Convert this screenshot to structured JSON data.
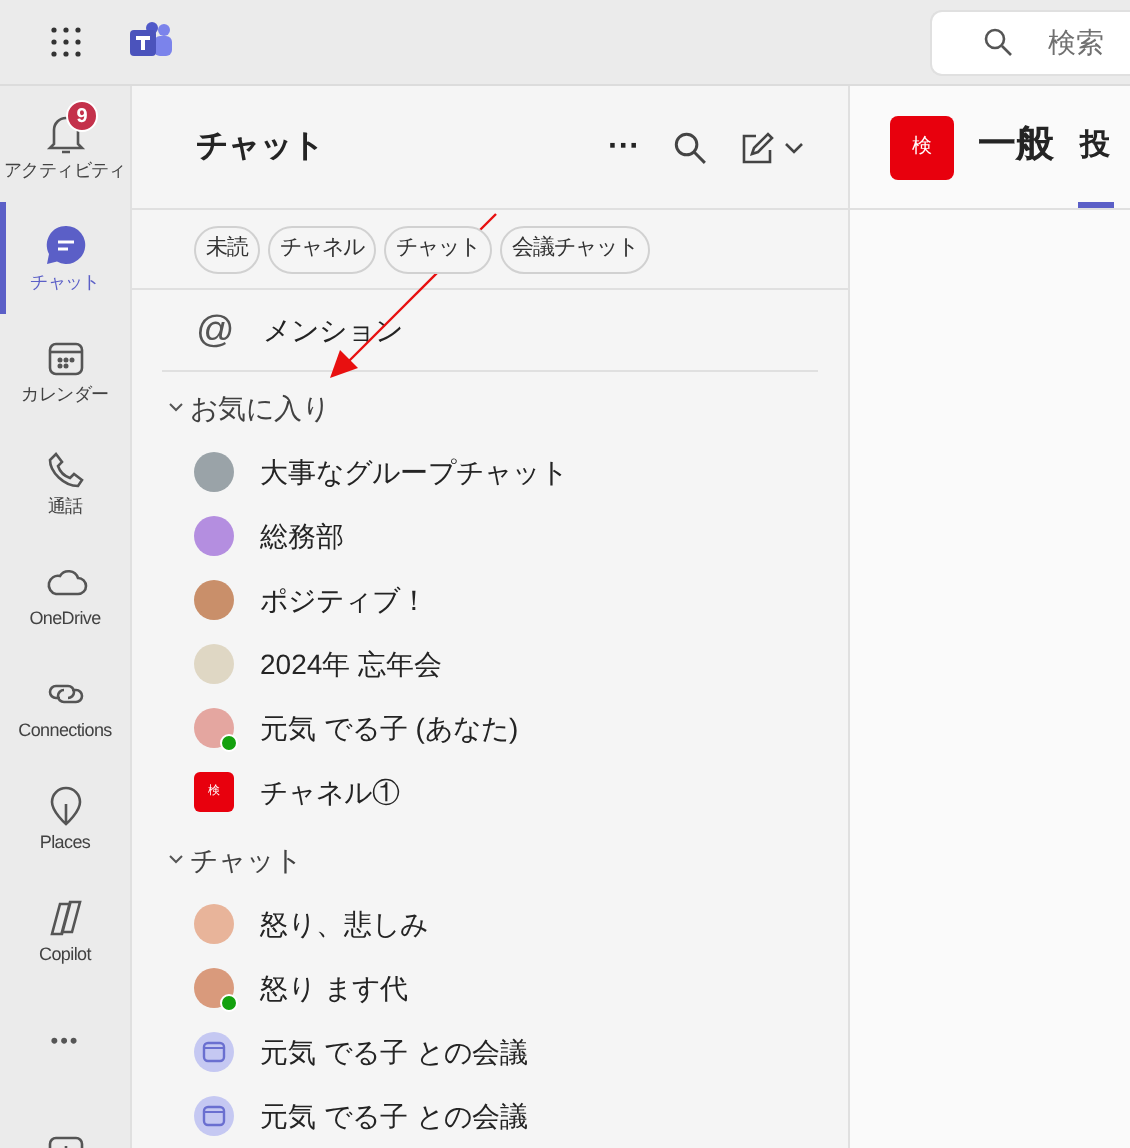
{
  "top_bar": {
    "search": {
      "placeholder": "検索"
    }
  },
  "rail": {
    "items": [
      {
        "kind": "bell",
        "label": "アクティビティ",
        "selected": false,
        "badge": "9"
      },
      {
        "kind": "chat",
        "label": "チャット",
        "selected": true
      },
      {
        "kind": "calendar",
        "label": "カレンダー",
        "selected": false
      },
      {
        "kind": "phone",
        "label": "通話",
        "selected": false
      },
      {
        "kind": "cloud",
        "label": "OneDrive",
        "selected": false
      },
      {
        "kind": "link",
        "label": "Connections",
        "selected": false
      },
      {
        "kind": "pin",
        "label": "Places",
        "selected": false
      },
      {
        "kind": "copilot",
        "label": "Copilot",
        "selected": false
      },
      {
        "kind": "more",
        "label": "•••",
        "selected": false
      },
      {
        "kind": "add",
        "selected": false
      }
    ]
  },
  "chat_panel": {
    "title": "チャット",
    "more": "···",
    "filters": [
      {
        "label": "未読"
      },
      {
        "label": "チャネル"
      },
      {
        "label": "チャット"
      },
      {
        "label": "会議チャット"
      }
    ],
    "mention": {
      "icon": "@",
      "label": "メンション"
    },
    "sections": [
      {
        "title": "お気に入り",
        "expanded": true,
        "items": [
          {
            "kind": "person",
            "label": "大事なグループチャット",
            "color": "#9aa3a8",
            "available": false
          },
          {
            "kind": "person",
            "label": "総務部",
            "color": "#b48ee0",
            "available": false
          },
          {
            "kind": "person",
            "label": "ポジティブ！",
            "color": "#c98f6a",
            "available": false
          },
          {
            "kind": "person",
            "label": "2024年 忘年会",
            "color": "#dfd7c4",
            "available": false
          },
          {
            "kind": "person",
            "label": "元気 でる子 (あなた)",
            "color": "#e4a6a0",
            "available": true
          },
          {
            "kind": "channel",
            "label": "チャネル①",
            "tile": "検"
          }
        ]
      },
      {
        "title": "チャット",
        "expanded": true,
        "items": [
          {
            "kind": "person",
            "label": "怒り、悲しみ",
            "color": "#e8b49a",
            "available": false
          },
          {
            "kind": "person",
            "label": "怒り ます代",
            "color": "#d99a7c",
            "available": true
          },
          {
            "kind": "meeting",
            "label": "元気 でる子 との会議"
          },
          {
            "kind": "meeting",
            "label": "元気 でる子 との会議"
          }
        ]
      }
    ]
  },
  "channel_header": {
    "tile": "検",
    "title": "一般",
    "tabs": [
      {
        "label": "投",
        "selected": true
      }
    ]
  }
}
